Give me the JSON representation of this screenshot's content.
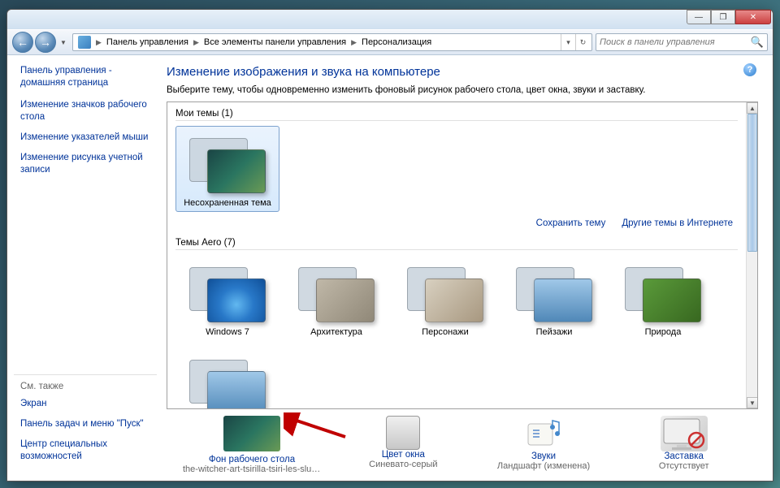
{
  "breadcrumb": {
    "item1": "Панель управления",
    "item2": "Все элементы панели управления",
    "item3": "Персонализация"
  },
  "search": {
    "placeholder": "Поиск в панели управления"
  },
  "sidebar": {
    "home": "Панель управления - домашняя страница",
    "link1": "Изменение значков рабочего стола",
    "link2": "Изменение указателей мыши",
    "link3": "Изменение рисунка учетной записи",
    "see_also_title": "См. также",
    "see1": "Экран",
    "see2": "Панель задач и меню \"Пуск\"",
    "see3": "Центр специальных возможностей"
  },
  "main": {
    "title": "Изменение изображения и звука на компьютере",
    "subtitle": "Выберите тему, чтобы одновременно изменить фоновый рисунок рабочего стола, цвет окна, звуки и заставку.",
    "sections": {
      "my_themes": "Мои темы (1)",
      "aero_themes": "Темы Aero (7)"
    },
    "actions": {
      "save": "Сохранить тему",
      "more": "Другие темы в Интернете"
    },
    "my": {
      "unsaved": "Несохраненная тема"
    },
    "aero": {
      "t1": "Windows 7",
      "t2": "Архитектура",
      "t3": "Персонажи",
      "t4": "Пейзажи",
      "t5": "Природа"
    }
  },
  "bottom": {
    "bg_label": "Фон рабочего стола",
    "bg_sub": "the-witcher-art-tsirilla-tsiri-les-sluc...",
    "color_label": "Цвет окна",
    "color_sub": "Синевато-серый",
    "sound_label": "Звуки",
    "sound_sub": "Ландшафт (изменена)",
    "saver_label": "Заставка",
    "saver_sub": "Отсутствует"
  }
}
